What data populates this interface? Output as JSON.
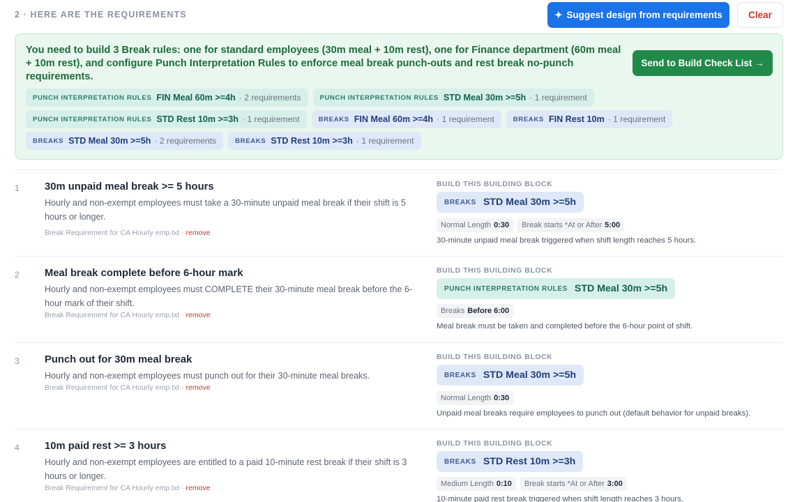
{
  "header": {
    "section_title": "2 · HERE ARE THE REQUIREMENTS",
    "suggest_icon": "✦",
    "suggest_label": "Suggest design from requirements",
    "clear_label": "Clear"
  },
  "summary": {
    "text": "You need to build 3 Break rules: one for standard employees (30m meal + 10m rest), one for Finance department (60m meal + 10m rest), and configure Punch Interpretation Rules to enforce meal break punch-outs and rest break no-punch requirements.",
    "send_label": "Send to Build Check List →",
    "chips": [
      [
        {
          "kind": "PUNCH INTERPRETATION RULES",
          "name": "FIN Meal 60m >=4h",
          "count": "· 2 requirements",
          "type": "pir"
        },
        {
          "kind": "PUNCH INTERPRETATION RULES",
          "name": "STD Meal 30m >=5h",
          "count": "· 1 requirement",
          "type": "pir"
        }
      ],
      [
        {
          "kind": "PUNCH INTERPRETATION RULES",
          "name": "STD Rest 10m >=3h",
          "count": "· 1 requirement",
          "type": "pir"
        },
        {
          "kind": "BREAKS",
          "name": "FIN Meal 60m >=4h",
          "count": "· 1 requirement",
          "type": "brk"
        },
        {
          "kind": "BREAKS",
          "name": "FIN Rest 10m",
          "count": "· 1 requirement",
          "type": "brk"
        }
      ],
      [
        {
          "kind": "BREAKS",
          "name": "STD Meal 30m >=5h",
          "count": "· 2 requirements",
          "type": "brk"
        },
        {
          "kind": "BREAKS",
          "name": "STD Rest 10m >=3h",
          "count": "· 1 requirement",
          "type": "brk"
        }
      ]
    ]
  },
  "block_label": "BUILD THIS BUILDING BLOCK",
  "requirements": [
    {
      "num": "1",
      "title": "30m unpaid meal break >= 5 hours",
      "desc": "Hourly and non-exempt employees must take a 30-minute unpaid meal break if their shift is 5 hours or longer.",
      "source": "Break Requirement for CA Hourly emp.txt",
      "remove": "remove",
      "block": {
        "kind": "BREAKS",
        "name": "STD Meal 30m >=5h",
        "type": "brk"
      },
      "props": [
        {
          "label": "Normal Length",
          "value": "0:30"
        },
        {
          "label": "Break starts *At or After",
          "value": "5:00"
        }
      ],
      "block_desc": "30-minute unpaid meal break triggered when shift length reaches 5 hours."
    },
    {
      "num": "2",
      "title": "Meal break complete before 6-hour mark",
      "desc": "Hourly and non-exempt employees must COMPLETE their 30-minute meal break before the 6-hour mark of their shift.",
      "source": "Break Requirement for CA Hourly emp.txt",
      "remove": "remove",
      "block": {
        "kind": "PUNCH INTERPRETATION RULES",
        "name": "STD Meal 30m >=5h",
        "type": "pir"
      },
      "props": [
        {
          "label": "Breaks",
          "value": "Before 6:00"
        }
      ],
      "block_desc": "Meal break must be taken and completed before the 6-hour point of shift."
    },
    {
      "num": "3",
      "title": "Punch out for 30m meal break",
      "desc": "Hourly and non-exempt employees must punch out for their 30-minute meal breaks.",
      "source": "Break Requirement for CA Hourly emp.txt",
      "remove": "remove",
      "block": {
        "kind": "BREAKS",
        "name": "STD Meal 30m >=5h",
        "type": "brk"
      },
      "props": [
        {
          "label": "Normal Length",
          "value": "0:30"
        }
      ],
      "block_desc": "Unpaid meal breaks require employees to punch out (default behavior for unpaid breaks)."
    },
    {
      "num": "4",
      "title": "10m paid rest >= 3 hours",
      "desc": "Hourly and non-exempt employees are entitled to a paid 10-minute rest break if their shift is 3 hours or longer.",
      "source": "Break Requirement for CA Hourly emp.txt",
      "remove": "remove",
      "block": {
        "kind": "BREAKS",
        "name": "STD Rest 10m >=3h",
        "type": "brk"
      },
      "props": [
        {
          "label": "Medium Length",
          "value": "0:10"
        },
        {
          "label": "Break starts *At or After",
          "value": "3:00"
        }
      ],
      "block_desc": "10-minute paid rest break triggered when shift length reaches 3 hours."
    }
  ]
}
